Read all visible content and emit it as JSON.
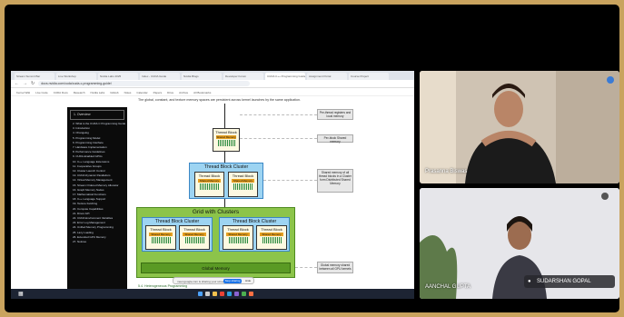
{
  "browser": {
    "tabs": [
      "Stream Summit Bar",
      "Live Workshop",
      "Nvidia Labs 2025",
      "Index - CUDA Guide",
      "Nvidia Blogs",
      "Developer Forum",
      "CUDA C++ Programming Guide",
      "Assignment Portal",
      "Course Project"
    ],
    "url": "docs.nvidia.com/cuda/cuda-c-programming-guide/",
    "bookmarks": [
      "Kernel Wiki",
      "Live Code",
      "CUDA Docs",
      "Research",
      "Nvidia Labs",
      "GitHub",
      "Notes",
      "Calendar",
      "Papers",
      "Drive",
      "Archive",
      "All Bookmarks"
    ]
  },
  "sidebar": {
    "header": "1. Overview",
    "items": [
      "2. What is the CUDA C Programming Guide",
      "3. Introduction",
      "4. Changelog",
      "5. Programming Model",
      "6. Programming Interface",
      "7. Hardware Implementation",
      "8. Performance Guidelines",
      "9. CUDA-Enabled GPUs",
      "10. C++ Language Extensions",
      "11. Cooperative Groups",
      "12. Cluster Launch Control",
      "13. CUDA Dynamic Parallelism",
      "14. Virtual Memory Management",
      "15. Stream Ordered Memory Allocator",
      "16. Graph Memory Nodes",
      "17. Mathematical Functions",
      "18. C++ Language Support",
      "19. Texture Fetching",
      "20. Compute Capabilities",
      "21. Driver API",
      "22. CUDA Environment Variables",
      "23. Error Log Management",
      "24. Unified Memory Programming",
      "25. Lazy Loading",
      "26. Extended GPU Memory",
      "27. Notices"
    ]
  },
  "diagram": {
    "intro": "The global, constant, and texture memory spaces are persistent across kernel launches by the same application.",
    "thread_block": "Thread Block",
    "shared_memory": "Shared Memory",
    "thread_block_cluster": "Thread Block Cluster",
    "grid_with_clusters": "Grid with Clusters",
    "global_memory": "Global Memory",
    "labels": {
      "per_thread": "Per-thread registers and local memory",
      "per_block": "Per-block Shared memory",
      "cluster_shared": "Shared memory of all thread blocks in a Cluster form Distributed Shared Memory",
      "global": "Global memory shared between all GPU kernels"
    },
    "figure_caption": "Figure 6 Memory Hierarchy",
    "next_heading": "5.4. Heterogeneous Programming"
  },
  "share_popup": {
    "text": "meet.google.com is sharing your screen.",
    "stop_label": "Stop sharing",
    "hide_label": "Hide"
  },
  "participants": [
    {
      "name": "Prasanna Biswas"
    },
    {
      "name": "AANCHAL GUPTA"
    }
  ],
  "presenter": {
    "name": "SUDARSHAN GOPAL"
  }
}
